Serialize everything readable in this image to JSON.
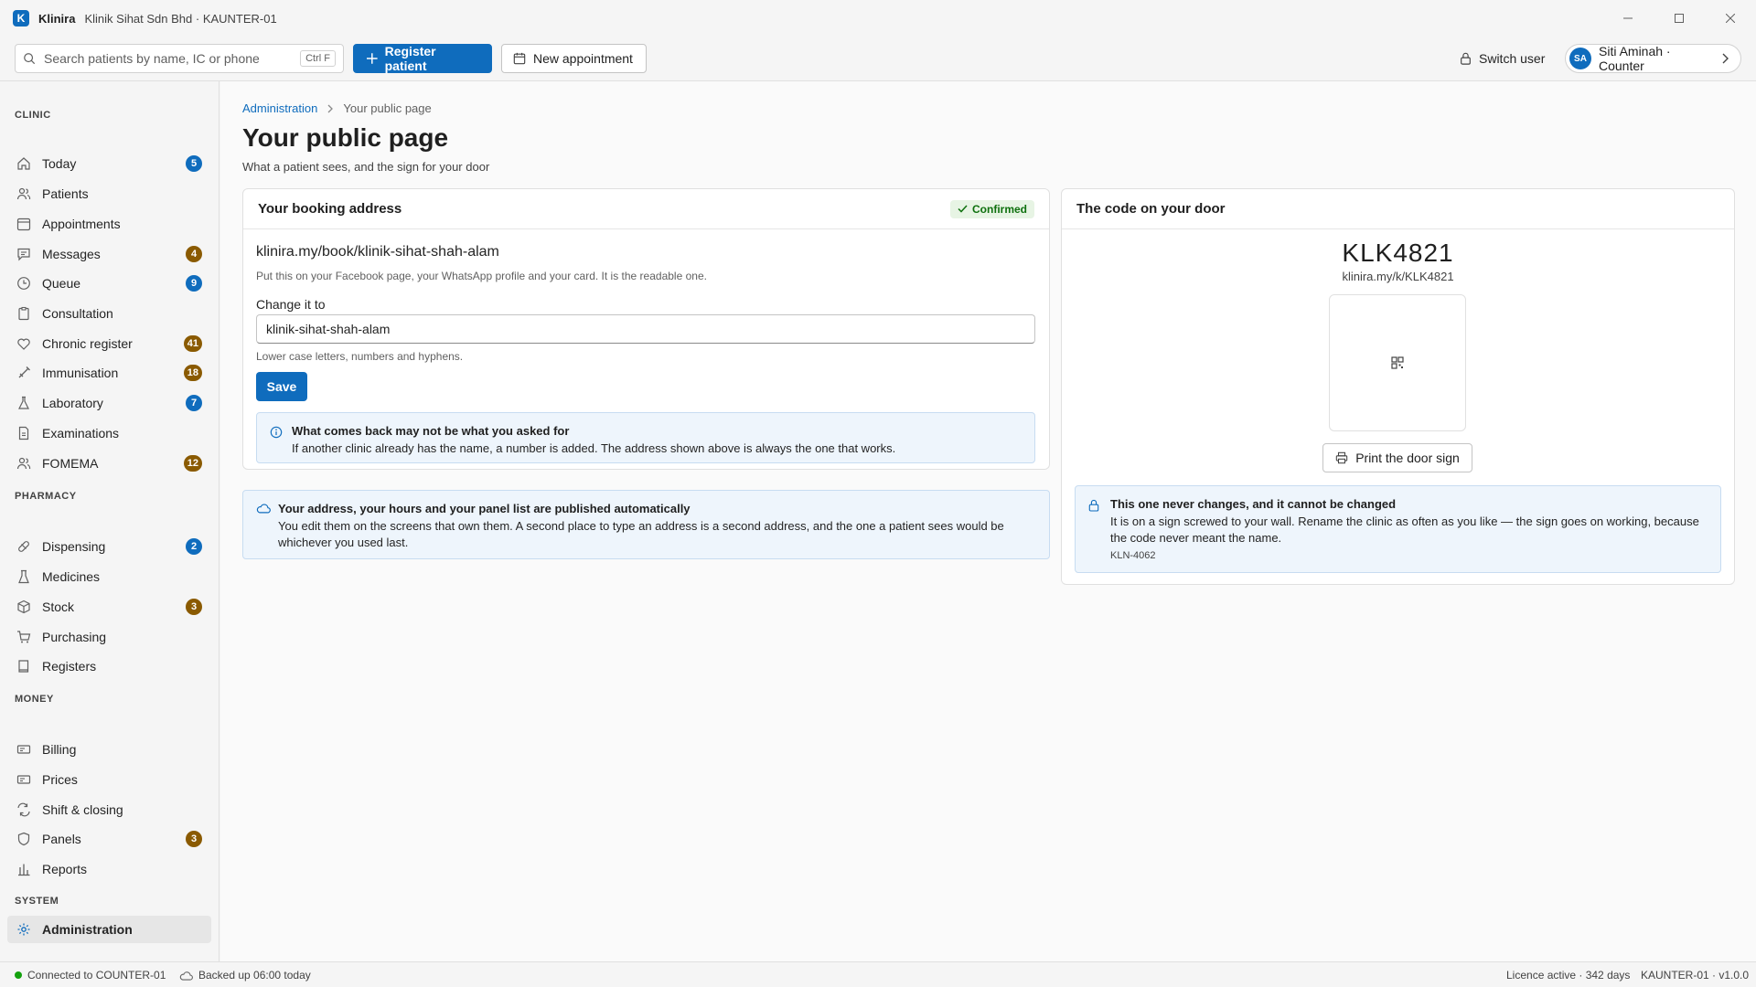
{
  "window": {
    "app_name": "Klinira",
    "logo_letter": "K",
    "subtitle": "Klinik Sihat Sdn Bhd · KAUNTER-01"
  },
  "toolbar": {
    "search_placeholder": "Search patients by name, IC or phone",
    "search_shortcut": "Ctrl F",
    "register_label": "Register patient",
    "new_appointment_label": "New appointment",
    "switch_user_label": "Switch user",
    "user_initials": "SA",
    "user_label": "Siti Aminah · Counter"
  },
  "sidebar": {
    "sections": {
      "clinic": "CLINIC",
      "pharmacy": "PHARMACY",
      "money": "MONEY",
      "system": "SYSTEM"
    },
    "items": [
      {
        "label": "Today",
        "badge": "5",
        "badge_color": "#0f6cbd",
        "icon": "home-icon"
      },
      {
        "label": "Patients",
        "badge": null,
        "icon": "people-icon"
      },
      {
        "label": "Appointments",
        "badge": null,
        "icon": "calendar-icon"
      },
      {
        "label": "Messages",
        "badge": "4",
        "badge_color": "#8a5a00",
        "icon": "chat-icon"
      },
      {
        "label": "Queue",
        "badge": "9",
        "badge_color": "#0f6cbd",
        "icon": "clock-icon"
      },
      {
        "label": "Consultation",
        "badge": null,
        "icon": "clipboard-icon"
      },
      {
        "label": "Chronic register",
        "badge": "41",
        "badge_color": "#8a5a00",
        "icon": "heart-icon"
      },
      {
        "label": "Immunisation",
        "badge": "18",
        "badge_color": "#8a5a00",
        "icon": "syringe-icon"
      },
      {
        "label": "Laboratory",
        "badge": "7",
        "badge_color": "#0f6cbd",
        "icon": "flask-icon"
      },
      {
        "label": "Examinations",
        "badge": null,
        "icon": "document-icon"
      },
      {
        "label": "FOMEMA",
        "badge": "12",
        "badge_color": "#8a5a00",
        "icon": "people-icon"
      },
      {
        "label": "Dispensing",
        "badge": "2",
        "badge_color": "#0f6cbd",
        "icon": "pill-icon"
      },
      {
        "label": "Medicines",
        "badge": null,
        "icon": "beaker-icon"
      },
      {
        "label": "Stock",
        "badge": "3",
        "badge_color": "#8a5a00",
        "icon": "box-icon"
      },
      {
        "label": "Purchasing",
        "badge": null,
        "icon": "cart-icon"
      },
      {
        "label": "Registers",
        "badge": null,
        "icon": "book-icon"
      },
      {
        "label": "Billing",
        "badge": null,
        "icon": "money-icon"
      },
      {
        "label": "Prices",
        "badge": null,
        "icon": "money-icon"
      },
      {
        "label": "Shift & closing",
        "badge": null,
        "icon": "repeat-icon"
      },
      {
        "label": "Panels",
        "badge": "3",
        "badge_color": "#8a5a00",
        "icon": "shield-icon"
      },
      {
        "label": "Reports",
        "badge": null,
        "icon": "bar-chart-icon"
      },
      {
        "label": "Administration",
        "badge": null,
        "icon": "gear-icon",
        "active": true
      }
    ]
  },
  "breadcrumb": {
    "parent": "Administration",
    "current": "Your public page"
  },
  "page": {
    "title": "Your public page",
    "subtitle": "What a patient sees, and the sign for your door"
  },
  "booking": {
    "title": "Your booking address",
    "status": "Confirmed",
    "address": "klinira.my/book/klinik-sihat-shah-alam",
    "help": "Put this on your Facebook page, your WhatsApp profile and your card. It is the readable one.",
    "field_label": "Change it to",
    "field_value": "klinik-sihat-shah-alam",
    "field_hint": "Lower case letters, numbers and hyphens.",
    "save_label": "Save",
    "notice_title": "What comes back may not be what you asked for",
    "notice_text": "If another clinic already has the name, a number is added. The address shown above is always the one that works."
  },
  "published_notice": {
    "title": "Your address, your hours and your panel list are published automatically",
    "text": "You edit them on the screens that own them. A second place to type an address is a second address, and the one a patient sees would be whichever you used last."
  },
  "door": {
    "title": "The code on your door",
    "code": "KLK4821",
    "url": "klinira.my/k/KLK4821",
    "print_label": "Print the door sign",
    "notice_title": "This one never changes, and it cannot be changed",
    "notice_text": "It is on a sign screwed to your wall. Rename the clinic as often as you like — the sign goes on working, because the code never meant the name.",
    "notice_code": "KLN-4062"
  },
  "status": {
    "connection": "Connected to COUNTER-01",
    "backup": "Backed up 06:00 today",
    "licence": "Licence active · 342 days",
    "version": "KAUNTER-01 · v1.0.0"
  }
}
